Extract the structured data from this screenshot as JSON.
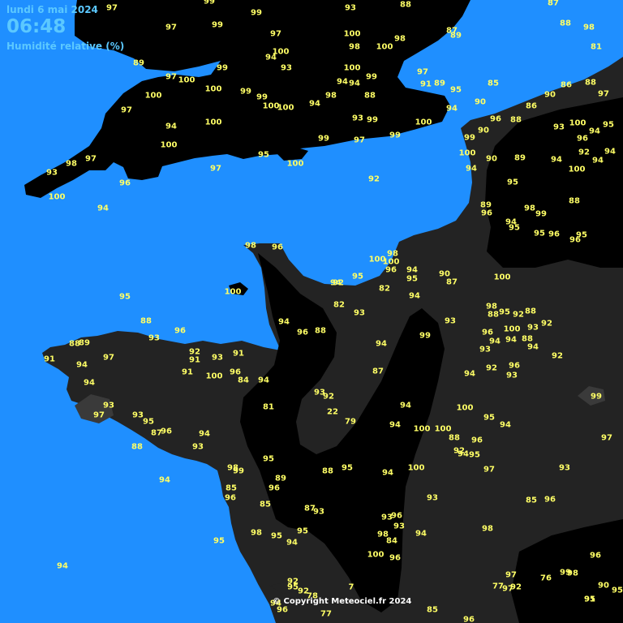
{
  "header": {
    "date": "lundi 6 mai 2024",
    "time": "06:48",
    "parameter": "Humidité relative (%)"
  },
  "copyright": "© Copyright Meteociel.fr 2024",
  "colors": {
    "sea": "#1f8fff",
    "land_moist": "#000000",
    "land_dry": "#232323",
    "label": "#ffff66",
    "header": "#5bc8ff"
  },
  "values": [
    {
      "v": "97"
    },
    {
      "v": "99"
    },
    {
      "v": "99"
    },
    {
      "v": "93"
    },
    {
      "v": "88"
    },
    {
      "v": "87"
    },
    {
      "v": "97"
    },
    {
      "v": "99"
    },
    {
      "v": "97"
    },
    {
      "v": "100"
    },
    {
      "v": "98"
    },
    {
      "v": "87"
    },
    {
      "v": "89"
    },
    {
      "v": "88"
    },
    {
      "v": "98"
    },
    {
      "v": "89"
    },
    {
      "v": "94"
    },
    {
      "v": "100"
    },
    {
      "v": "93"
    },
    {
      "v": "98"
    },
    {
      "v": "100"
    },
    {
      "v": "81"
    },
    {
      "v": "97"
    },
    {
      "v": "100"
    },
    {
      "v": "99"
    },
    {
      "v": "100"
    },
    {
      "v": "94"
    },
    {
      "v": "94"
    },
    {
      "v": "99"
    },
    {
      "v": "97"
    },
    {
      "v": "91"
    },
    {
      "v": "89"
    },
    {
      "v": "95"
    },
    {
      "v": "85"
    },
    {
      "v": "86"
    },
    {
      "v": "88"
    },
    {
      "v": "100"
    },
    {
      "v": "100"
    },
    {
      "v": "99"
    },
    {
      "v": "99"
    },
    {
      "v": "100"
    },
    {
      "v": "98"
    },
    {
      "v": "88"
    },
    {
      "v": "90"
    },
    {
      "v": "97"
    },
    {
      "v": "97"
    },
    {
      "v": "100"
    },
    {
      "v": "94"
    },
    {
      "v": "94"
    },
    {
      "v": "90"
    },
    {
      "v": "86"
    },
    {
      "v": "94"
    },
    {
      "v": "100"
    },
    {
      "v": "93"
    },
    {
      "v": "99"
    },
    {
      "v": "100"
    },
    {
      "v": "88"
    },
    {
      "v": "93"
    },
    {
      "v": "100"
    },
    {
      "v": "94"
    },
    {
      "v": "95"
    },
    {
      "v": "99"
    },
    {
      "v": "97"
    },
    {
      "v": "99"
    },
    {
      "v": "99"
    },
    {
      "v": "90"
    },
    {
      "v": "96"
    },
    {
      "v": "96"
    },
    {
      "v": "97"
    },
    {
      "v": "98"
    },
    {
      "v": "100"
    },
    {
      "v": "100"
    },
    {
      "v": "90"
    },
    {
      "v": "89"
    },
    {
      "v": "92"
    },
    {
      "v": "94"
    },
    {
      "v": "94"
    },
    {
      "v": "93"
    },
    {
      "v": "97"
    },
    {
      "v": "95"
    },
    {
      "v": "100"
    },
    {
      "v": "94"
    },
    {
      "v": "94"
    },
    {
      "v": "100"
    },
    {
      "v": "96"
    },
    {
      "v": "92"
    },
    {
      "v": "95"
    },
    {
      "v": "100"
    },
    {
      "v": "94"
    },
    {
      "v": "89"
    },
    {
      "v": "96"
    },
    {
      "v": "88"
    },
    {
      "v": "98"
    },
    {
      "v": "99"
    },
    {
      "v": "94"
    },
    {
      "v": "95"
    },
    {
      "v": "95"
    },
    {
      "v": "96"
    },
    {
      "v": "96"
    },
    {
      "v": "95"
    },
    {
      "v": "98"
    },
    {
      "v": "96"
    },
    {
      "v": "100"
    },
    {
      "v": "98"
    },
    {
      "v": "100"
    },
    {
      "v": "96"
    },
    {
      "v": "94"
    },
    {
      "v": "95"
    },
    {
      "v": "90"
    },
    {
      "v": "87"
    },
    {
      "v": "100"
    },
    {
      "v": "100"
    },
    {
      "v": "94"
    },
    {
      "v": "92"
    },
    {
      "v": "95"
    },
    {
      "v": "82"
    },
    {
      "v": "94"
    },
    {
      "v": "95"
    },
    {
      "v": "82"
    },
    {
      "v": "93"
    },
    {
      "v": "98"
    },
    {
      "v": "88"
    },
    {
      "v": "95"
    },
    {
      "v": "92"
    },
    {
      "v": "88"
    },
    {
      "v": "88"
    },
    {
      "v": "93"
    },
    {
      "v": "96"
    },
    {
      "v": "94"
    },
    {
      "v": "93"
    },
    {
      "v": "92"
    },
    {
      "v": "93"
    },
    {
      "v": "96"
    },
    {
      "v": "88"
    },
    {
      "v": "96"
    },
    {
      "v": "99"
    },
    {
      "v": "94"
    },
    {
      "v": "100"
    },
    {
      "v": "94"
    },
    {
      "v": "88"
    },
    {
      "v": "94"
    },
    {
      "v": "88"
    },
    {
      "v": "89"
    },
    {
      "v": "97"
    },
    {
      "v": "92"
    },
    {
      "v": "93"
    },
    {
      "v": "91"
    },
    {
      "v": "91"
    },
    {
      "v": "94"
    },
    {
      "v": "93"
    },
    {
      "v": "92"
    },
    {
      "v": "91"
    },
    {
      "v": "94"
    },
    {
      "v": "91"
    },
    {
      "v": "100"
    },
    {
      "v": "96"
    },
    {
      "v": "87"
    },
    {
      "v": "92"
    },
    {
      "v": "96"
    },
    {
      "v": "94"
    },
    {
      "v": "84"
    },
    {
      "v": "94"
    },
    {
      "v": "94"
    },
    {
      "v": "93"
    },
    {
      "v": "93"
    },
    {
      "v": "92"
    },
    {
      "v": "99"
    },
    {
      "v": "93"
    },
    {
      "v": "81"
    },
    {
      "v": "94"
    },
    {
      "v": "100"
    },
    {
      "v": "97"
    },
    {
      "v": "93"
    },
    {
      "v": "22"
    },
    {
      "v": "95"
    },
    {
      "v": "79"
    },
    {
      "v": "94"
    },
    {
      "v": "100"
    },
    {
      "v": "100"
    },
    {
      "v": "95"
    },
    {
      "v": "94"
    },
    {
      "v": "87"
    },
    {
      "v": "96"
    },
    {
      "v": "94"
    },
    {
      "v": "88"
    },
    {
      "v": "96"
    },
    {
      "v": "97"
    },
    {
      "v": "88"
    },
    {
      "v": "93"
    },
    {
      "v": "92"
    },
    {
      "v": "94"
    },
    {
      "v": "95"
    },
    {
      "v": "95"
    },
    {
      "v": "98"
    },
    {
      "v": "99"
    },
    {
      "v": "88"
    },
    {
      "v": "95"
    },
    {
      "v": "94"
    },
    {
      "v": "100"
    },
    {
      "v": "97"
    },
    {
      "v": "93"
    },
    {
      "v": "94"
    },
    {
      "v": "89"
    },
    {
      "v": "85"
    },
    {
      "v": "96"
    },
    {
      "v": "85"
    },
    {
      "v": "93"
    },
    {
      "v": "96"
    },
    {
      "v": "96"
    },
    {
      "v": "85"
    },
    {
      "v": "87"
    },
    {
      "v": "93"
    },
    {
      "v": "93"
    },
    {
      "v": "96"
    },
    {
      "v": "98"
    },
    {
      "v": "95"
    },
    {
      "v": "95"
    },
    {
      "v": "93"
    },
    {
      "v": "98"
    },
    {
      "v": "94"
    },
    {
      "v": "98"
    },
    {
      "v": "95"
    },
    {
      "v": "94"
    },
    {
      "v": "84"
    },
    {
      "v": "100"
    },
    {
      "v": "96"
    },
    {
      "v": "96"
    },
    {
      "v": "94"
    },
    {
      "v": "97"
    },
    {
      "v": "76"
    },
    {
      "v": "99"
    },
    {
      "v": "98"
    },
    {
      "v": "92"
    },
    {
      "v": "7"
    },
    {
      "v": "77"
    },
    {
      "v": "97"
    },
    {
      "v": "92"
    },
    {
      "v": "90"
    },
    {
      "v": "95"
    },
    {
      "v": "95"
    },
    {
      "v": "92"
    },
    {
      "v": "78"
    },
    {
      "v": "91"
    },
    {
      "v": "94"
    },
    {
      "v": "96"
    },
    {
      "v": "77"
    },
    {
      "v": "85"
    },
    {
      "v": "96"
    },
    {
      "v": "95"
    },
    {
      "v": "87"
    },
    {
      "v": "93"
    }
  ]
}
